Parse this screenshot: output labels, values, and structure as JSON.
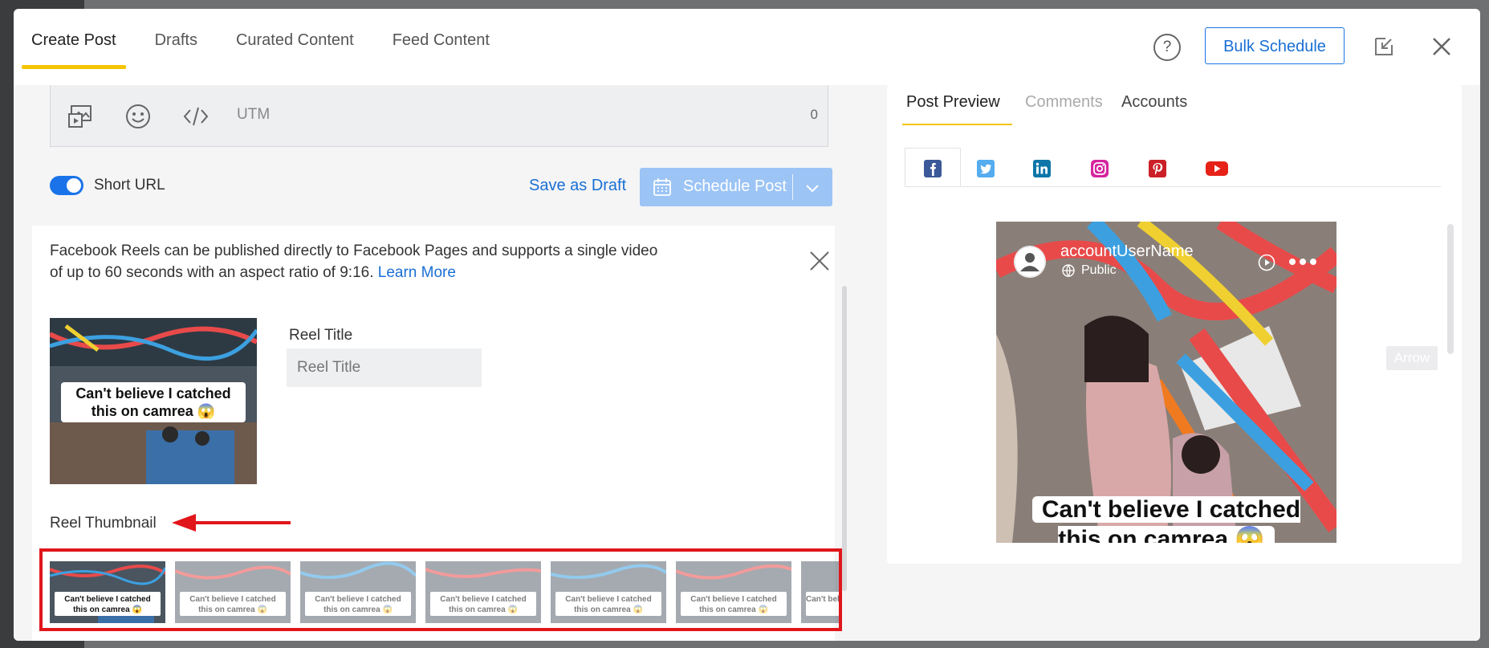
{
  "header": {
    "tabs": [
      {
        "label": "Create Post",
        "active": true
      },
      {
        "label": "Drafts"
      },
      {
        "label": "Curated Content"
      },
      {
        "label": "Feed Content"
      }
    ],
    "help_label": "?",
    "bulk_schedule_label": "Bulk Schedule"
  },
  "editor": {
    "utm_label": "UTM",
    "char_count": "0",
    "icons": [
      "media-icon",
      "emoji-icon",
      "code-icon"
    ]
  },
  "actions": {
    "short_url_label": "Short URL",
    "short_url_enabled": true,
    "save_draft_label": "Save as Draft",
    "schedule_label": "Schedule Post"
  },
  "reels": {
    "info_text": "Facebook Reels can be published directly to Facebook Pages and supports a single video of up to 60 seconds with an aspect ratio of 9:16.",
    "learn_more": "Learn More",
    "title_label": "Reel Title",
    "title_placeholder": "Reel Title",
    "thumbnail_label": "Reel Thumbnail",
    "caption": "Can't believe I catched this on camrea 😱"
  },
  "preview": {
    "tabs": [
      "Post Preview",
      "Comments",
      "Accounts"
    ],
    "social_networks": [
      "facebook",
      "twitter",
      "linkedin",
      "instagram",
      "pinterest",
      "youtube"
    ],
    "account_name": "accountUserName",
    "visibility": "Public",
    "caption": "Can't believe I catched this on camrea 😱",
    "ghost_label": "Arrow"
  },
  "colors": {
    "accent": "#1a73e8",
    "tab_underline": "#f5c400",
    "annotation_red": "#e0161b",
    "schedule_disabled": "#9cc4f5"
  }
}
